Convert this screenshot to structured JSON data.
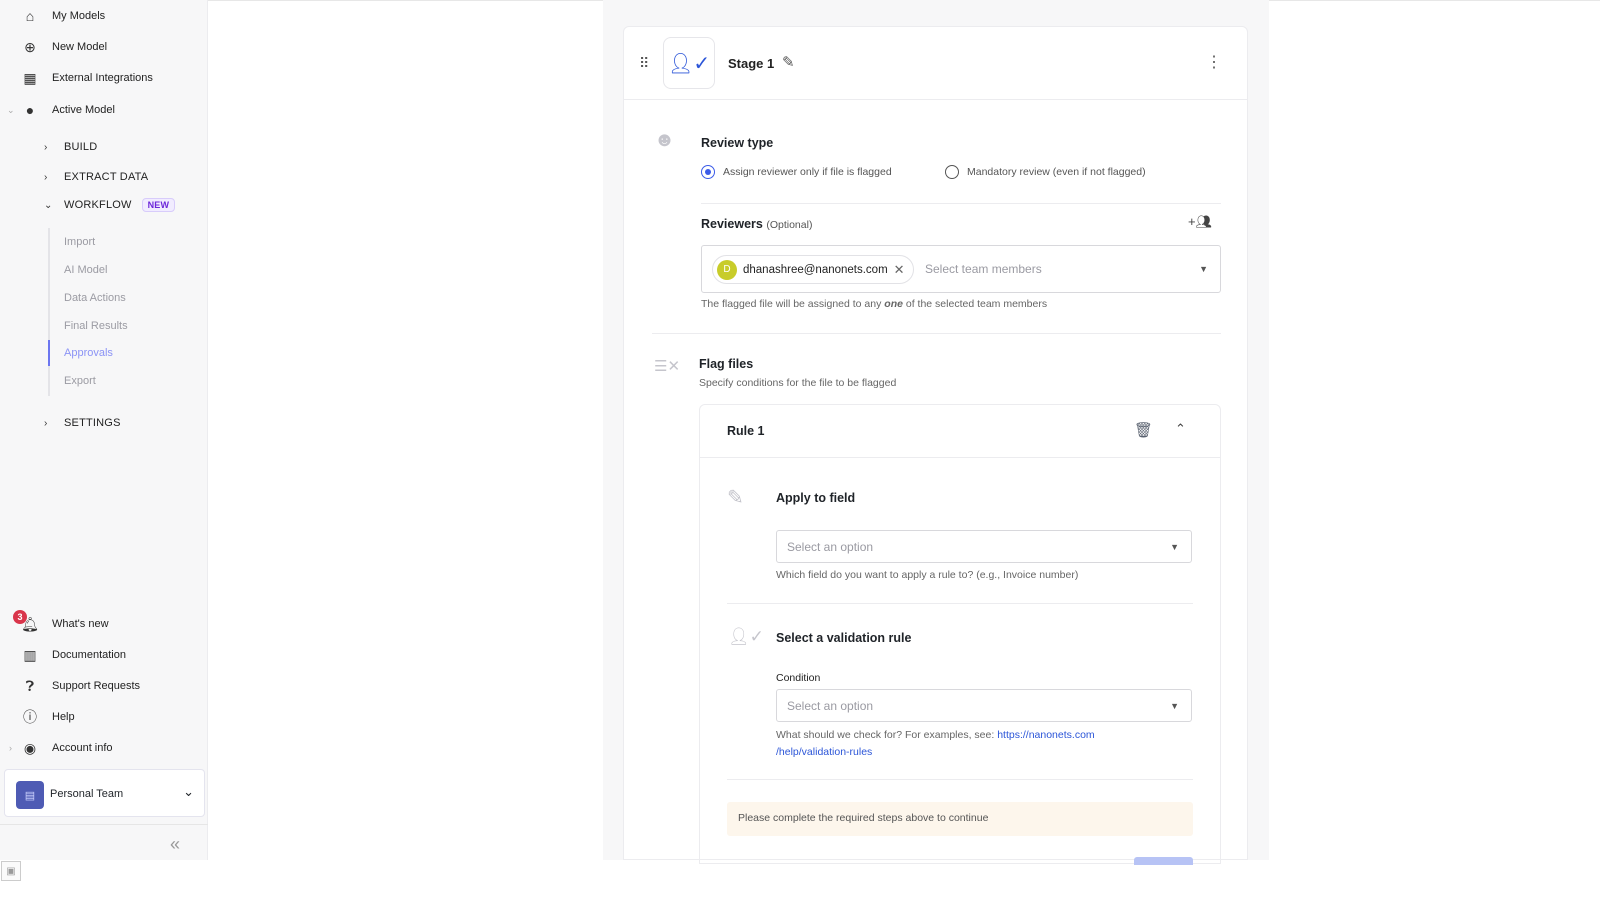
{
  "sidebar": {
    "top_items": [
      {
        "label": "My Models",
        "icon": "home-icon"
      },
      {
        "label": "New Model",
        "icon": "plus-circle-icon"
      },
      {
        "label": "External Integrations",
        "icon": "grid-icon"
      },
      {
        "label": "Active Model",
        "icon": "compass-icon"
      }
    ],
    "sections": [
      {
        "label": "BUILD",
        "expanded": false
      },
      {
        "label": "EXTRACT DATA",
        "expanded": false
      },
      {
        "label": "WORKFLOW",
        "expanded": true,
        "badge": "NEW"
      },
      {
        "label": "SETTINGS",
        "expanded": false
      }
    ],
    "workflow_items": [
      "Import",
      "AI Model",
      "Data Actions",
      "Final Results",
      "Approvals",
      "Export"
    ],
    "active_item": "Approvals",
    "bottom_items": [
      {
        "label": "What's new",
        "icon": "bell-icon",
        "badge": "3"
      },
      {
        "label": "Documentation",
        "icon": "book-icon"
      },
      {
        "label": "Support Requests",
        "icon": "question-filled-icon"
      },
      {
        "label": "Help",
        "icon": "help-circle-icon"
      },
      {
        "label": "Account info",
        "icon": "account-icon"
      }
    ],
    "team": "Personal Team"
  },
  "stage": {
    "title": "Stage 1",
    "review_type": {
      "title": "Review type",
      "options": [
        "Assign reviewer only if file is flagged",
        "Mandatory review (even if not flagged)"
      ],
      "selected": 0
    },
    "reviewers": {
      "title": "Reviewers",
      "optional": "(Optional)",
      "chip": {
        "initial": "D",
        "email": "dhanashree@nanonets.com"
      },
      "placeholder": "Select team members",
      "help_pre": "The flagged file will be assigned to any ",
      "help_em": "one",
      "help_post": " of the selected team members"
    },
    "flag_files": {
      "title": "Flag files",
      "subtitle": "Specify conditions for the file to be flagged",
      "rule": {
        "title": "Rule 1",
        "apply_title": "Apply to field",
        "apply_placeholder": "Select an option",
        "apply_help": "Which field do you want to apply a rule to? (e.g., Invoice number)",
        "validation_title": "Select a validation rule",
        "condition_label": "Condition",
        "condition_placeholder": "Select an option",
        "condition_help": "What should we check for? For examples, see: ",
        "link_1": "https://nanonets.com",
        "link_2": "/help/validation-rules",
        "warning": "Please complete the required steps above to continue"
      }
    }
  },
  "colors": {
    "accent": "#3b5be8",
    "sidebar_bg": "#f7f7f8",
    "warning_bg": "#fdf6ec",
    "badge": "#6d28d9"
  }
}
